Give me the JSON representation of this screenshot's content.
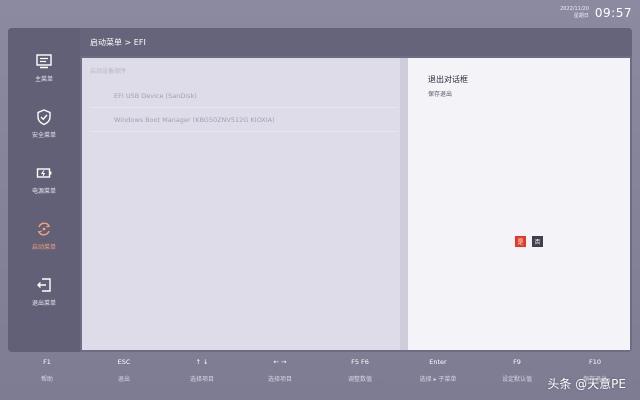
{
  "clock": {
    "date": "2022/11/20",
    "weekday": "星期日",
    "time": "09:57"
  },
  "breadcrumb": "启动菜单 > EFI",
  "sidebar": {
    "items": [
      {
        "label": "主菜单",
        "icon": "monitor-icon",
        "active": false
      },
      {
        "label": "安全菜单",
        "icon": "shield-check-icon",
        "active": false
      },
      {
        "label": "电源菜单",
        "icon": "battery-icon",
        "active": false
      },
      {
        "label": "启动菜单",
        "icon": "boot-refresh-icon",
        "active": true
      },
      {
        "label": "退出菜单",
        "icon": "exit-icon",
        "active": false
      }
    ]
  },
  "boot": {
    "section_label": "启动设备顺序",
    "devices": [
      "EFI USB Device (SanDisk)",
      "Windows Boot Manager (KBG50ZNV512G KIOXIA)"
    ]
  },
  "dialog": {
    "title": "退出对话框",
    "subtitle": "保存退出",
    "yes_label": "是",
    "no_label": "否"
  },
  "hints": [
    {
      "key": "F1",
      "desc": "帮助"
    },
    {
      "key": "ESC",
      "desc": "退出"
    },
    {
      "key": "↑ ↓",
      "desc": "选择项目"
    },
    {
      "key": "← →",
      "desc": "选择项目"
    },
    {
      "key": "F5  F6",
      "desc": "调整数值"
    },
    {
      "key": "Enter",
      "desc": "选择 ▸ 子菜单"
    },
    {
      "key": "F9",
      "desc": "设定默认值"
    },
    {
      "key": "F10",
      "desc": "保存退出"
    }
  ],
  "watermark": "头条 @天意PE",
  "colors": {
    "accent_active": "#f2a17a",
    "yes_button": "#e53a2a",
    "no_button": "#3f3f50"
  }
}
